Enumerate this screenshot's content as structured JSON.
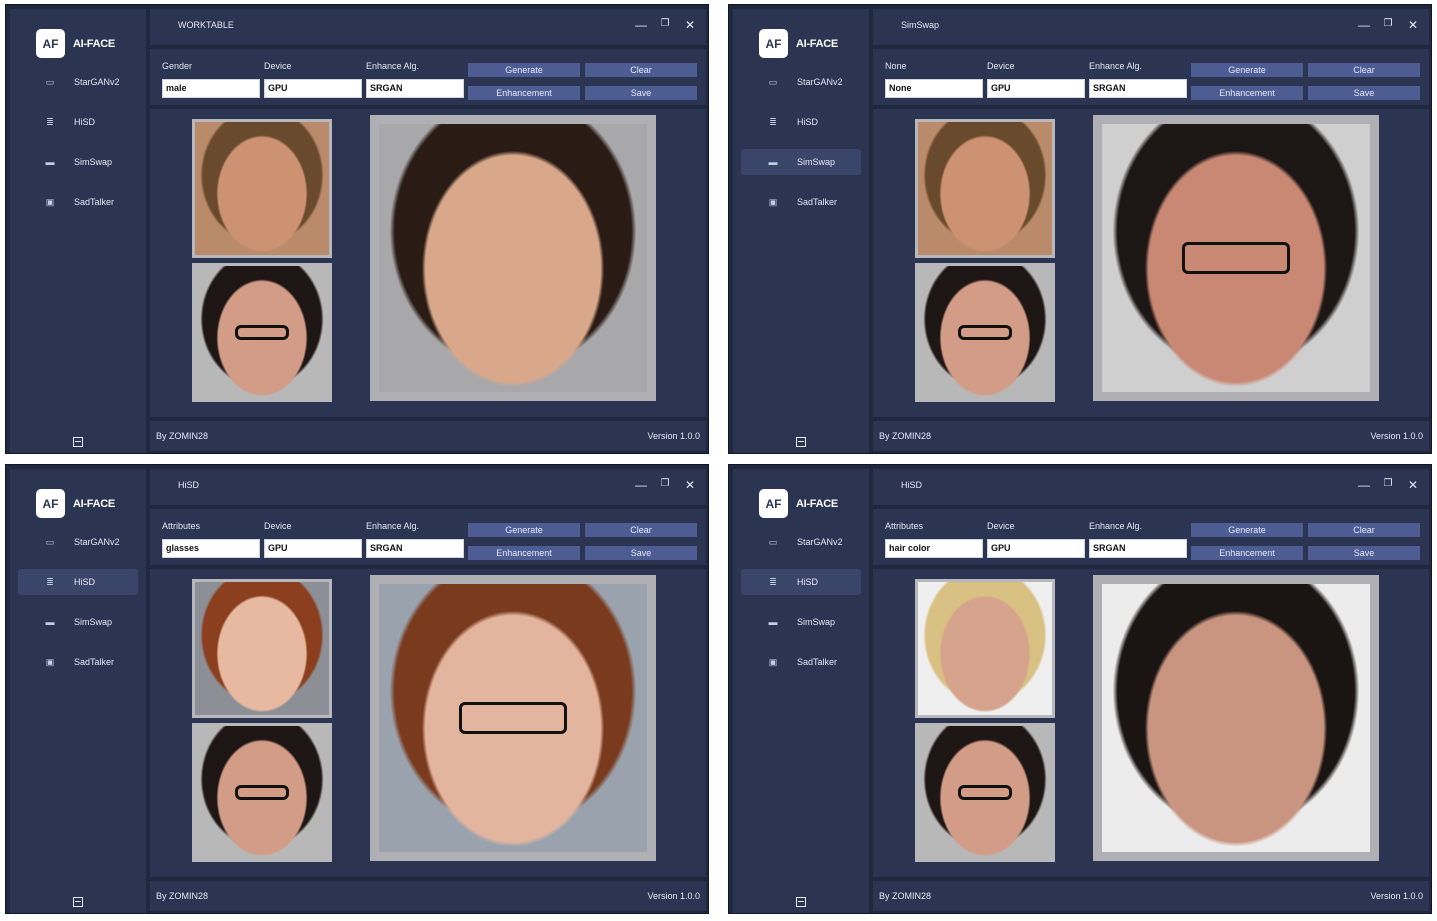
{
  "app": {
    "logo_badge": "AF",
    "logo_text": "AI-FACE",
    "nav": [
      "StarGANv2",
      "HiSD",
      "SimSwap",
      "SadTalker"
    ],
    "nav_icons": [
      "monitor-icon",
      "list-icon",
      "card-icon",
      "image-icon"
    ],
    "footer_left": "By ZOMIN28",
    "footer_right": "Version 1.0.0",
    "buttons": {
      "generate": "Generate",
      "clear": "Clear",
      "enhancement": "Enhancement",
      "save": "Save"
    },
    "labels": {
      "device": "Device",
      "enhance_alg": "Enhance Alg."
    },
    "window_controls": {
      "minimize": "—",
      "maximize": "❐",
      "close": "✕"
    }
  },
  "windows": [
    {
      "title": "WORKTABLE",
      "active_nav": -1,
      "field1_label": "Gender",
      "field1_value": "male",
      "device_value": "GPU",
      "enhance_value": "SRGAN",
      "colors": {
        "bg": "#a8a8ab",
        "skin": "#d9a88a",
        "hair": "#2a1c15"
      }
    },
    {
      "title": "SimSwap",
      "active_nav": 2,
      "field1_label": "None",
      "field1_value": "None",
      "device_value": "GPU",
      "enhance_value": "SRGAN",
      "colors": {
        "bg": "#cfcfcf",
        "skin": "#c98874",
        "hair": "#1c1614"
      }
    },
    {
      "title": "HiSD",
      "active_nav": 1,
      "field1_label": "Attributes",
      "field1_value": "glasses",
      "device_value": "GPU",
      "enhance_value": "SRGAN",
      "colors": {
        "bg": "#9aa3ad",
        "skin": "#e3b59e",
        "hair": "#7a3a1e"
      }
    },
    {
      "title": "HiSD",
      "active_nav": 1,
      "field1_label": "Attributes",
      "field1_value": "hair color",
      "device_value": "GPU",
      "enhance_value": "SRGAN",
      "colors": {
        "bg": "#ececec",
        "skin": "#c99580",
        "hair": "#1a1412"
      }
    }
  ]
}
